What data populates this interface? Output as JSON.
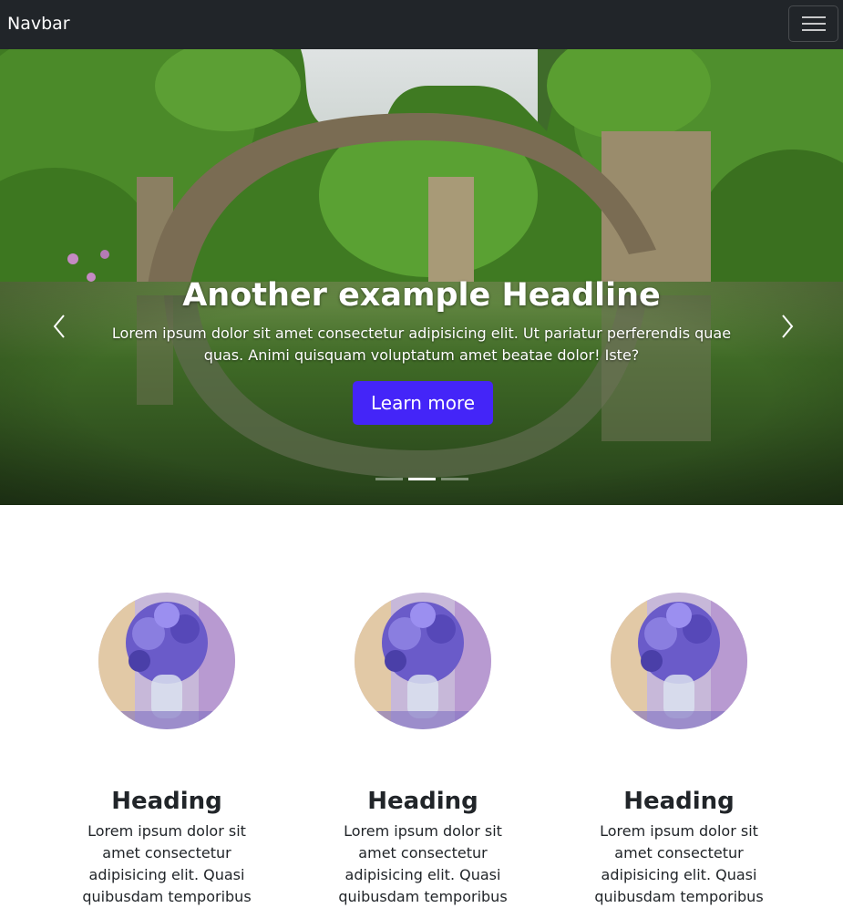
{
  "navbar": {
    "brand": "Navbar",
    "toggle_icon": "hamburger-icon",
    "background": "#212529"
  },
  "carousel": {
    "headline": "Another example Headline",
    "text": "Lorem ipsum dolor sit amet consectetur adipisicing elit. Ut pariatur perferendis quae quas. Animi quisquam voluptatum amet beatae dolor! Iste?",
    "button_label": "Learn more",
    "button_color": "#4425f8",
    "prev_icon": "chevron-left-icon",
    "next_icon": "chevron-right-icon",
    "slide_count": 3,
    "active_slide": 2,
    "image_subject": "stone arch bridge reflected in a forest lake"
  },
  "features": [
    {
      "heading": "Heading",
      "text": "Lorem ipsum dolor sit amet consectetur adipisicing elit. Quasi quibusdam temporibus",
      "image_subject": "vase of purple flowers"
    },
    {
      "heading": "Heading",
      "text": "Lorem ipsum dolor sit amet consectetur adipisicing elit. Quasi quibusdam temporibus",
      "image_subject": "vase of purple flowers"
    },
    {
      "heading": "Heading",
      "text": "Lorem ipsum dolor sit amet consectetur adipisicing elit. Quasi quibusdam temporibus",
      "image_subject": "vase of purple flowers"
    }
  ]
}
